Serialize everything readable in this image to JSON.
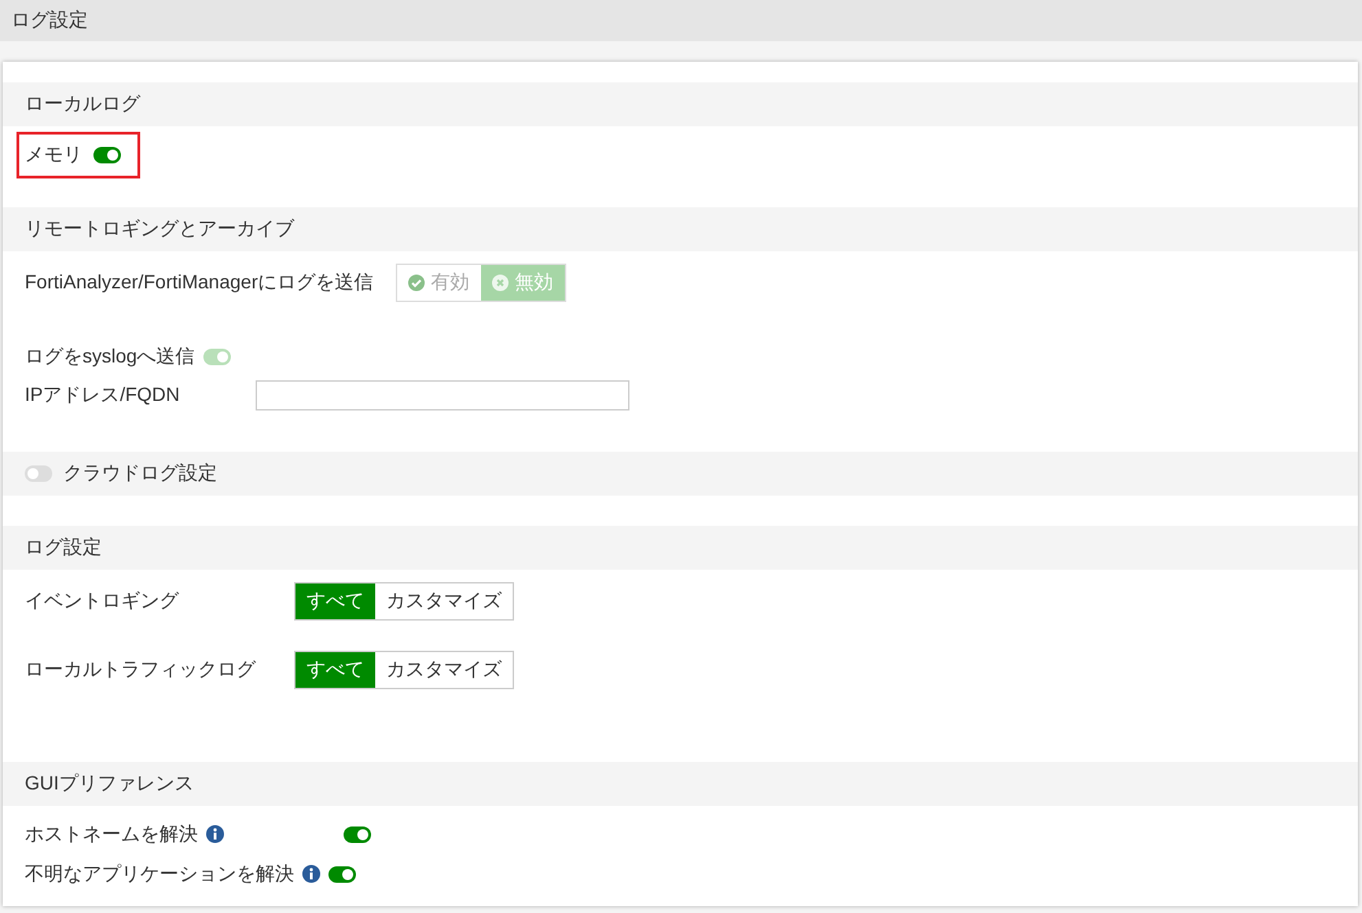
{
  "page_title": "ログ設定",
  "local_log": {
    "title": "ローカルログ",
    "memory": {
      "label": "メモリ",
      "on": true,
      "highlighted": true
    }
  },
  "remote": {
    "title": "リモートロギングとアーカイブ",
    "forti": {
      "label": "FortiAnalyzer/FortiManagerにログを送信",
      "disabled": true,
      "options": [
        {
          "label": "有効",
          "kind": "enable",
          "selected": false
        },
        {
          "label": "無効",
          "kind": "disable",
          "selected": true
        }
      ]
    },
    "syslog": {
      "label": "ログをsyslogへ送信",
      "on": true,
      "disabled": true
    },
    "ip": {
      "label": "IPアドレス/FQDN"
    }
  },
  "cloud": {
    "title": "クラウドログ設定",
    "on": false
  },
  "log_settings": {
    "title": "ログ設定",
    "rows": [
      {
        "label": "イベントロギング",
        "options": [
          {
            "label": "すべて",
            "selected": true
          },
          {
            "label": "カスタマイズ",
            "selected": false
          }
        ]
      },
      {
        "label": "ローカルトラフィックログ",
        "options": [
          {
            "label": "すべて",
            "selected": true
          },
          {
            "label": "カスタマイズ",
            "selected": false
          }
        ]
      }
    ]
  },
  "gui": {
    "title": "GUIプリファレンス",
    "rows": [
      {
        "label": "ホストネームを解決",
        "on": true
      },
      {
        "label": "不明なアプリケーションを解決",
        "on": true
      }
    ]
  }
}
